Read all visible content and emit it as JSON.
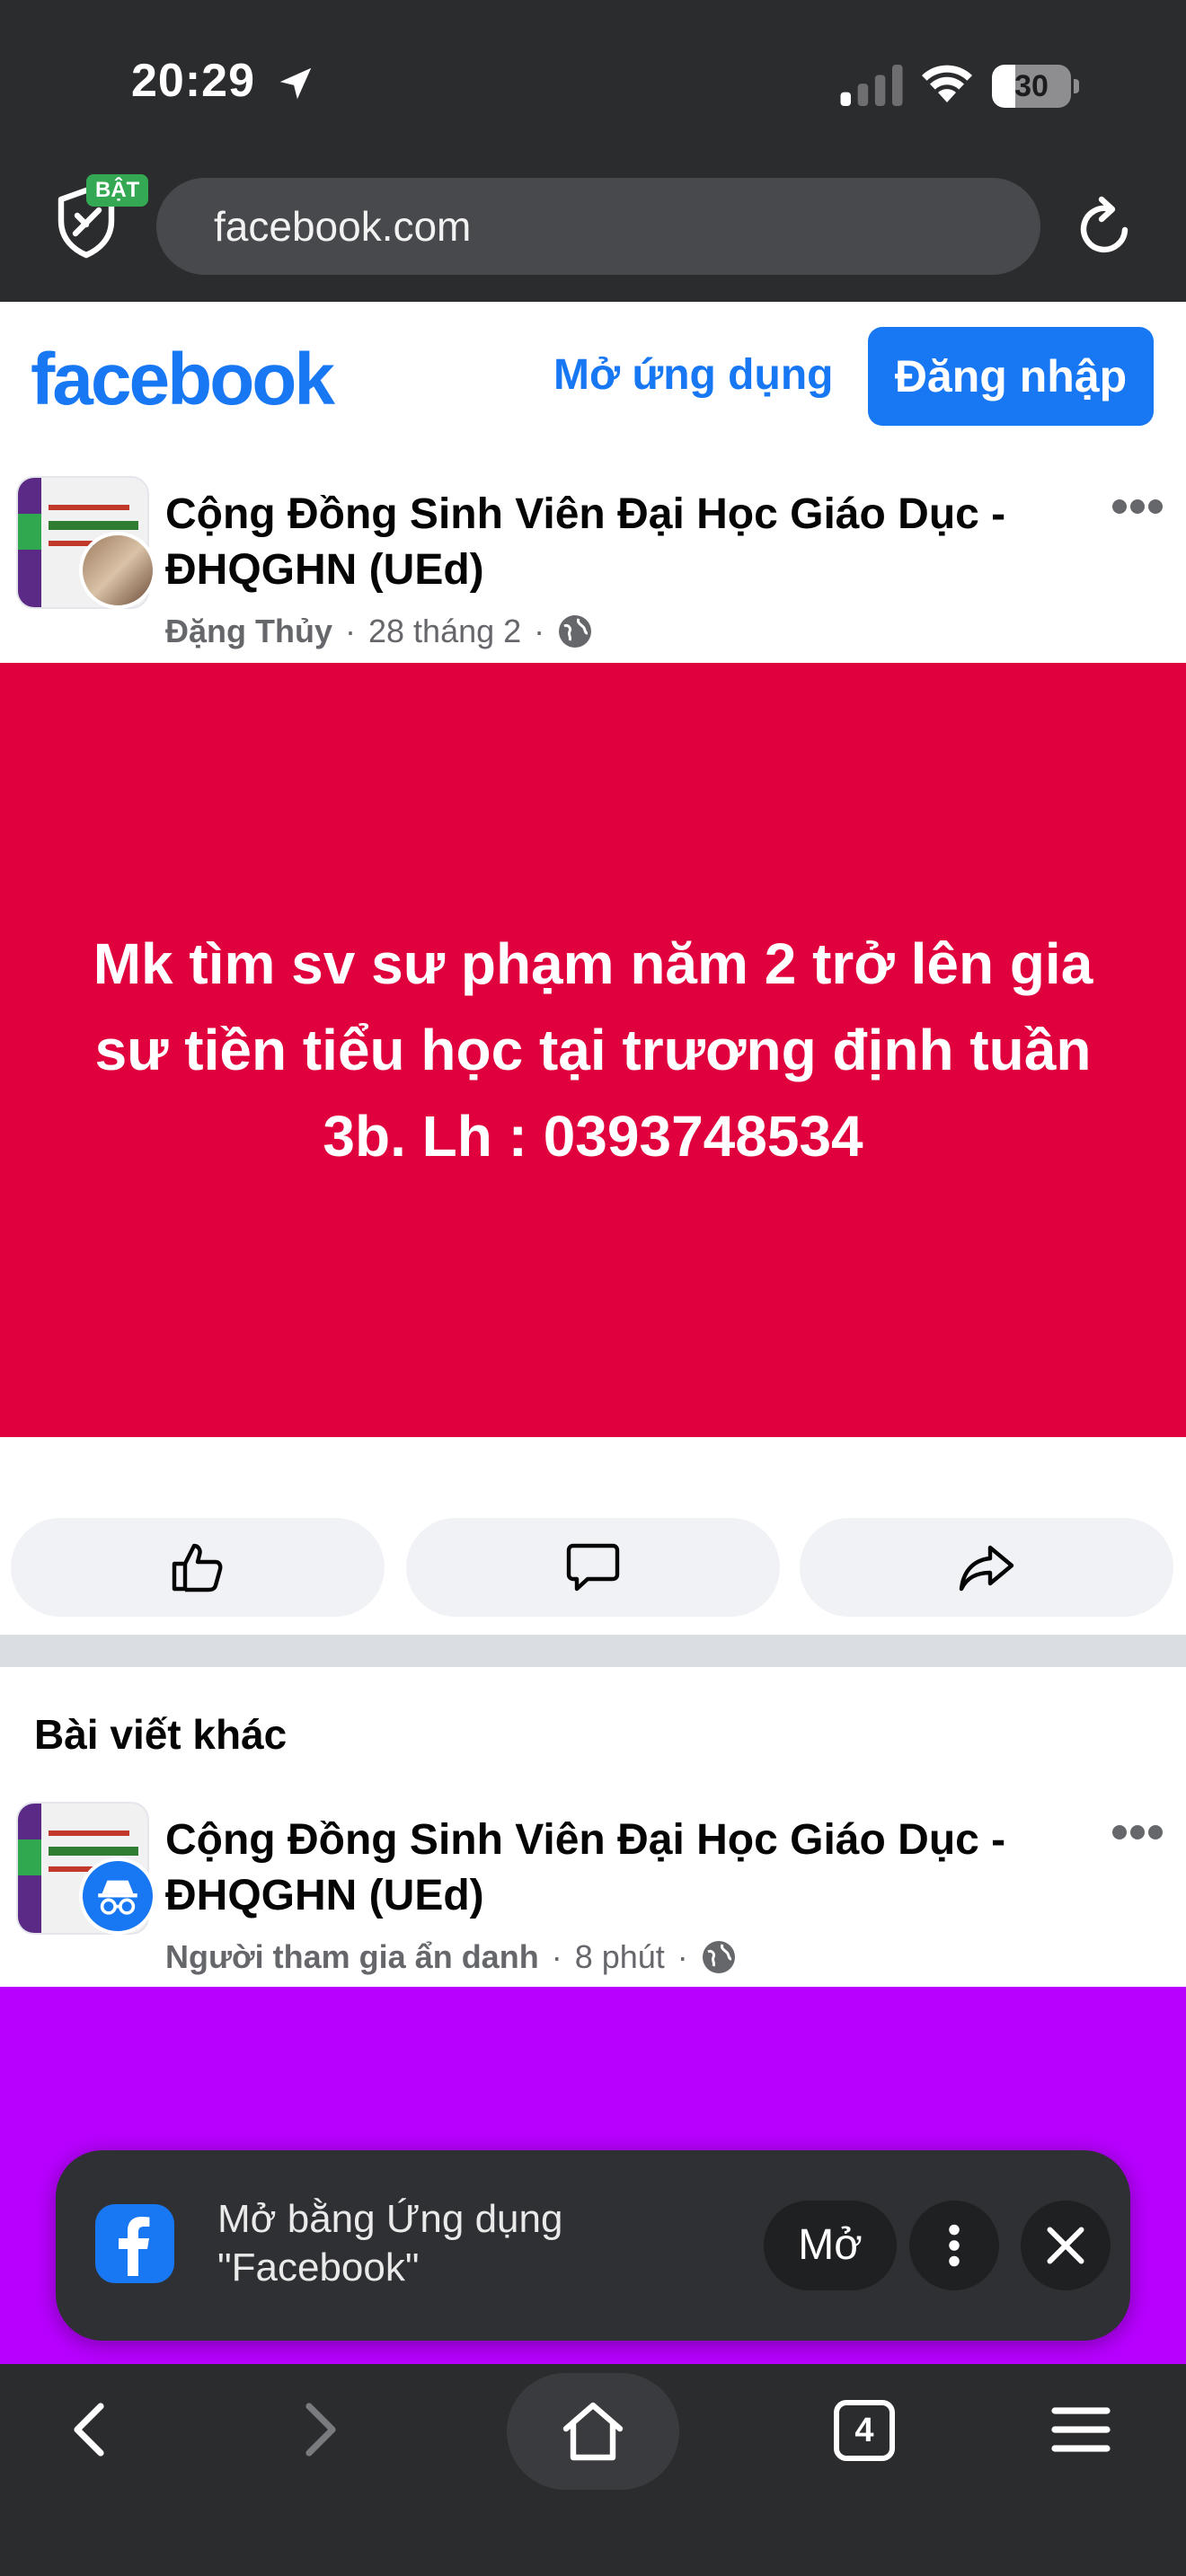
{
  "status_bar": {
    "time": "20:29",
    "battery": "30",
    "battery_level": 0.3
  },
  "browser": {
    "shield_badge": "BẬT",
    "url": "facebook.com"
  },
  "fb_header": {
    "logo": "facebook",
    "open_app": "Mở ứng dụng",
    "login": "Đăng nhập"
  },
  "post1": {
    "group": "Cộng Đồng Sinh Viên Đại Học Giáo Dục - ĐHQGHN (UEd)",
    "author": "Đặng Thủy",
    "date": "28 tháng 2",
    "text": "Mk tìm sv sư phạm năm 2 trở lên gia sư tiền tiểu học tại trương định tuần 3b. Lh : 0393748534",
    "background": "#e0003e"
  },
  "other_posts": {
    "heading": "Bài viết khác"
  },
  "post2": {
    "group": "Cộng Đồng Sinh Viên Đại Học Giáo Dục - ĐHQGHN (UEd)",
    "author": "Người tham gia ẩn danh",
    "date": "8 phút",
    "background": "#b800ff"
  },
  "app_banner": {
    "text": "Mở bằng Ứng dụng \"Facebook\"",
    "open_label": "Mở"
  },
  "toolbar": {
    "tab_count": "4"
  },
  "colors": {
    "fb_blue": "#1877f2",
    "chrome_bg": "#2b2c2e"
  },
  "icons": [
    "location-arrow-icon",
    "signal-icon",
    "wifi-icon",
    "shield-icon",
    "reload-icon",
    "globe-icon",
    "more-icon",
    "like-icon",
    "comment-icon",
    "share-icon",
    "incognito-icon",
    "facebook-app-icon",
    "close-icon",
    "back-icon",
    "forward-icon",
    "home-icon",
    "tabs-icon",
    "menu-icon"
  ]
}
